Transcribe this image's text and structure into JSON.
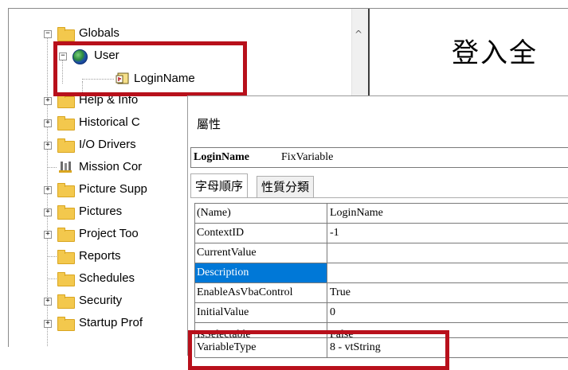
{
  "tree": {
    "items": [
      {
        "label": "Globals",
        "expander": "−"
      },
      {
        "label": "User",
        "expander": "−"
      },
      {
        "label": "LoginName"
      },
      {
        "label": "Help & Info",
        "expander": "+"
      },
      {
        "label": "Historical C",
        "expander": "+"
      },
      {
        "label": "I/O Drivers",
        "expander": "+"
      },
      {
        "label": "Mission Cor"
      },
      {
        "label": "Picture Supp",
        "expander": "+"
      },
      {
        "label": "Pictures",
        "expander": "+"
      },
      {
        "label": "Project Too",
        "expander": "+"
      },
      {
        "label": "Reports"
      },
      {
        "label": "Schedules"
      },
      {
        "label": "Security",
        "expander": "+"
      },
      {
        "label": "Startup Prof",
        "expander": "+"
      }
    ],
    "scroll_up_glyph": "^"
  },
  "banner": {
    "text": "登入全"
  },
  "properties": {
    "title": "屬性",
    "object_name": "LoginName",
    "object_type": "FixVariable",
    "combo_arrow": "⌄",
    "tabs": [
      {
        "label": "字母順序",
        "active": true
      },
      {
        "label": "性質分類",
        "active": false
      }
    ],
    "rows": [
      {
        "name": "(Name)",
        "value": "LoginName"
      },
      {
        "name": "ContextID",
        "value": "-1"
      },
      {
        "name": "CurrentValue",
        "value": ""
      },
      {
        "name": "Description",
        "value": "",
        "selected": true
      },
      {
        "name": "EnableAsVbaControl",
        "value": "True"
      },
      {
        "name": "InitialValue",
        "value": "0"
      },
      {
        "name": "IsSelectable",
        "value": "False"
      },
      {
        "name": "VariableType",
        "value": "8 - vtString"
      }
    ]
  },
  "colors": {
    "highlight": "#b8101b",
    "selection": "#0078d7",
    "folder": "#f3c84d"
  }
}
